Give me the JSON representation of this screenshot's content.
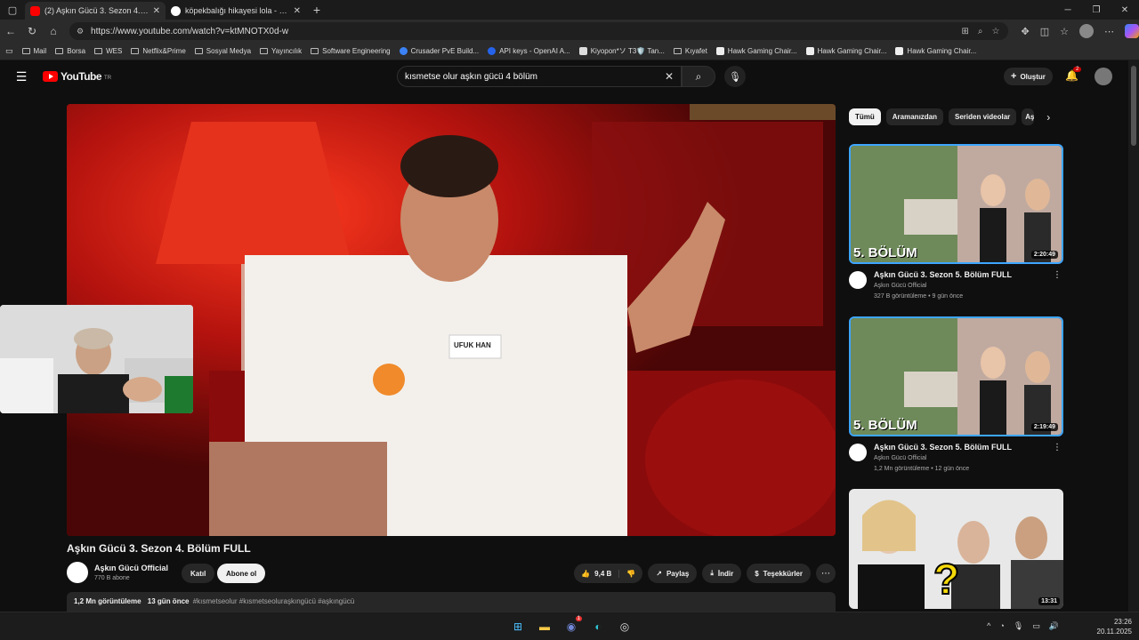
{
  "browser": {
    "tabs": [
      {
        "title": "(2) Aşkın Gücü 3. Sezon 4. Bölüm",
        "active": true
      },
      {
        "title": "köpekbalığı hikayesi lola - Google",
        "active": false
      }
    ],
    "url": "https://www.youtube.com/watch?v=ktMNOTX0d-w",
    "bookmarks": [
      "Mail",
      "Borsa",
      "WES",
      "Netflix&Prime",
      "Sosyal Medya",
      "Yayıncılık",
      "Software Engineering",
      "Crusader PvE Build...",
      "API keys - OpenAI A...",
      "Kiyopon*ソ T3🛡️ Tan...",
      "Kıyafet",
      "Hawk Gaming Chair...",
      "Hawk Gaming Chair...",
      "Hawk Gaming Chair..."
    ]
  },
  "youtube": {
    "logo_text": "YouTube",
    "country_code": "TR",
    "search_query": "kısmetse olur aşkın gücü 4 bölüm",
    "create_label": "Oluştur",
    "notification_count": "2"
  },
  "video": {
    "title": "Aşkın Gücü 3. Sezon 4. Bölüm FULL",
    "name_tag": "UFUK HAN",
    "channel": "Aşkın Gücü Official",
    "subscribers": "770 B abone",
    "join_label": "Katıl",
    "subscribe_label": "Abone ol",
    "likes": "9,4 B",
    "share_label": "Paylaş",
    "download_label": "İndir",
    "thanks_label": "Teşekkürler",
    "views": "1,2 Mn görüntüleme",
    "age": "13 gün önce",
    "hashtags": "#kısmetseolur #kısmetseoluraşkıngücü #aşkıngücü"
  },
  "chips": [
    "Tümü",
    "Aramanızdan",
    "Seriden videolar",
    "Aşk"
  ],
  "recommendations": [
    {
      "title": "Aşkın Gücü 3. Sezon 5. Bölüm FULL",
      "channel": "Aşkın Gücü Official",
      "stats": "327 B görüntüleme • 9 gün önce",
      "duration": "2:20:49",
      "label": "5. BÖLÜM"
    },
    {
      "title": "Aşkın Gücü 3. Sezon 5. Bölüm FULL",
      "channel": "Aşkın Gücü Official",
      "stats": "1,2 Mn görüntüleme • 12 gün önce",
      "duration": "2:19:49",
      "label": "5. BÖLÜM"
    },
    {
      "duration": "13:31"
    }
  ],
  "taskbar": {
    "time": "23:26",
    "date": "20.11.2025",
    "discord_badge": "1"
  },
  "colors": {
    "youtube_red": "#ff0000",
    "selection_blue": "#3ea6ff",
    "background": "#0f0f0f"
  }
}
